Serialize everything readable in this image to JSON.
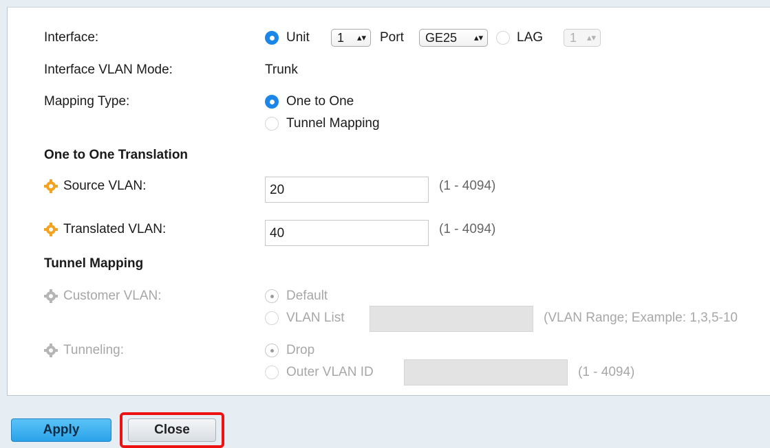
{
  "interface": {
    "label": "Interface:",
    "unit_label": "Unit",
    "unit_value": "1",
    "port_label": "Port",
    "port_value": "GE25",
    "lag_label": "LAG",
    "lag_value": "1"
  },
  "vlan_mode": {
    "label": "Interface VLAN Mode:",
    "value": "Trunk"
  },
  "mapping_type": {
    "label": "Mapping Type:",
    "option_one_to_one": "One to One",
    "option_tunnel": "Tunnel Mapping",
    "selected": "One to One"
  },
  "one_to_one": {
    "heading": "One to One Translation",
    "source_label": "Source VLAN:",
    "source_value": "20",
    "source_range": "(1 - 4094)",
    "translated_label": "Translated VLAN:",
    "translated_value": "40",
    "translated_range": "(1 - 4094)"
  },
  "tunnel_mapping": {
    "heading": "Tunnel Mapping",
    "customer_label": "Customer VLAN:",
    "customer_default": "Default",
    "customer_list": "VLAN List",
    "customer_list_value": "",
    "customer_hint": "(VLAN Range; Example: 1,3,5-10",
    "tunneling_label": "Tunneling:",
    "tunneling_drop": "Drop",
    "tunneling_outer": "Outer VLAN ID",
    "tunneling_outer_value": "",
    "tunneling_range": "(1 - 4094)"
  },
  "buttons": {
    "apply": "Apply",
    "close": "Close"
  },
  "colors": {
    "accent": "#1a86e8",
    "required_icon": "#f4a321",
    "highlight": "#ee1111",
    "apply_button": "#2aa3e9"
  },
  "icons": {
    "required": "gear-icon",
    "select_arrows": "updown-arrows-icon"
  }
}
